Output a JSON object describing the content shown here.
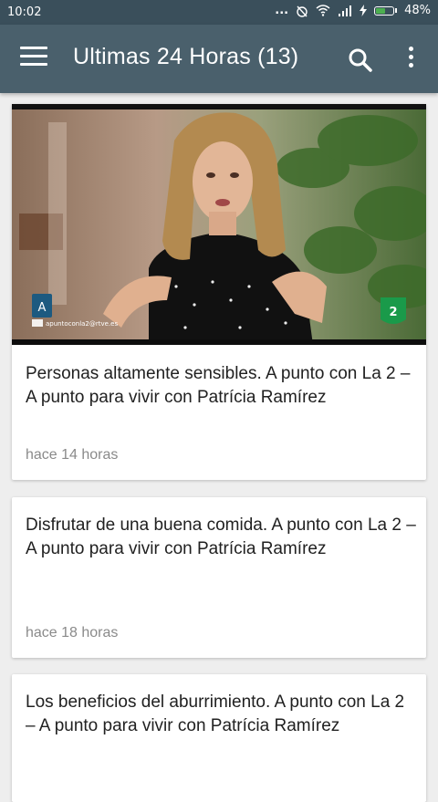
{
  "status_bar": {
    "time": "10:02",
    "more": "...",
    "battery_percent": "48%",
    "battery_level": 0.48
  },
  "app_bar": {
    "title": "Ultimas 24 Horas (13)",
    "menu_icon": "hamburger-menu-icon",
    "search_icon": "search-icon",
    "overflow_icon": "more-vert-icon",
    "color": "#4a606c"
  },
  "feed": {
    "cards": [
      {
        "title": "Personas altamente sensibles. A punto con La 2 – A punto para vivir con Patrícia Ramírez",
        "time_ago": "hace 14 horas",
        "thumbnail": {
          "caption": "apuntoconla2@rtve.es",
          "logo_letter": "A",
          "channel": "2"
        }
      },
      {
        "title": "Disfrutar de una buena comida. A punto con La 2 – A punto para vivir con Patrícia Ramírez",
        "time_ago": "hace 18 horas"
      },
      {
        "title": "Los beneficios del aburrimiento. A punto con La 2 – A punto para vivir con Patrícia Ramírez"
      }
    ]
  }
}
